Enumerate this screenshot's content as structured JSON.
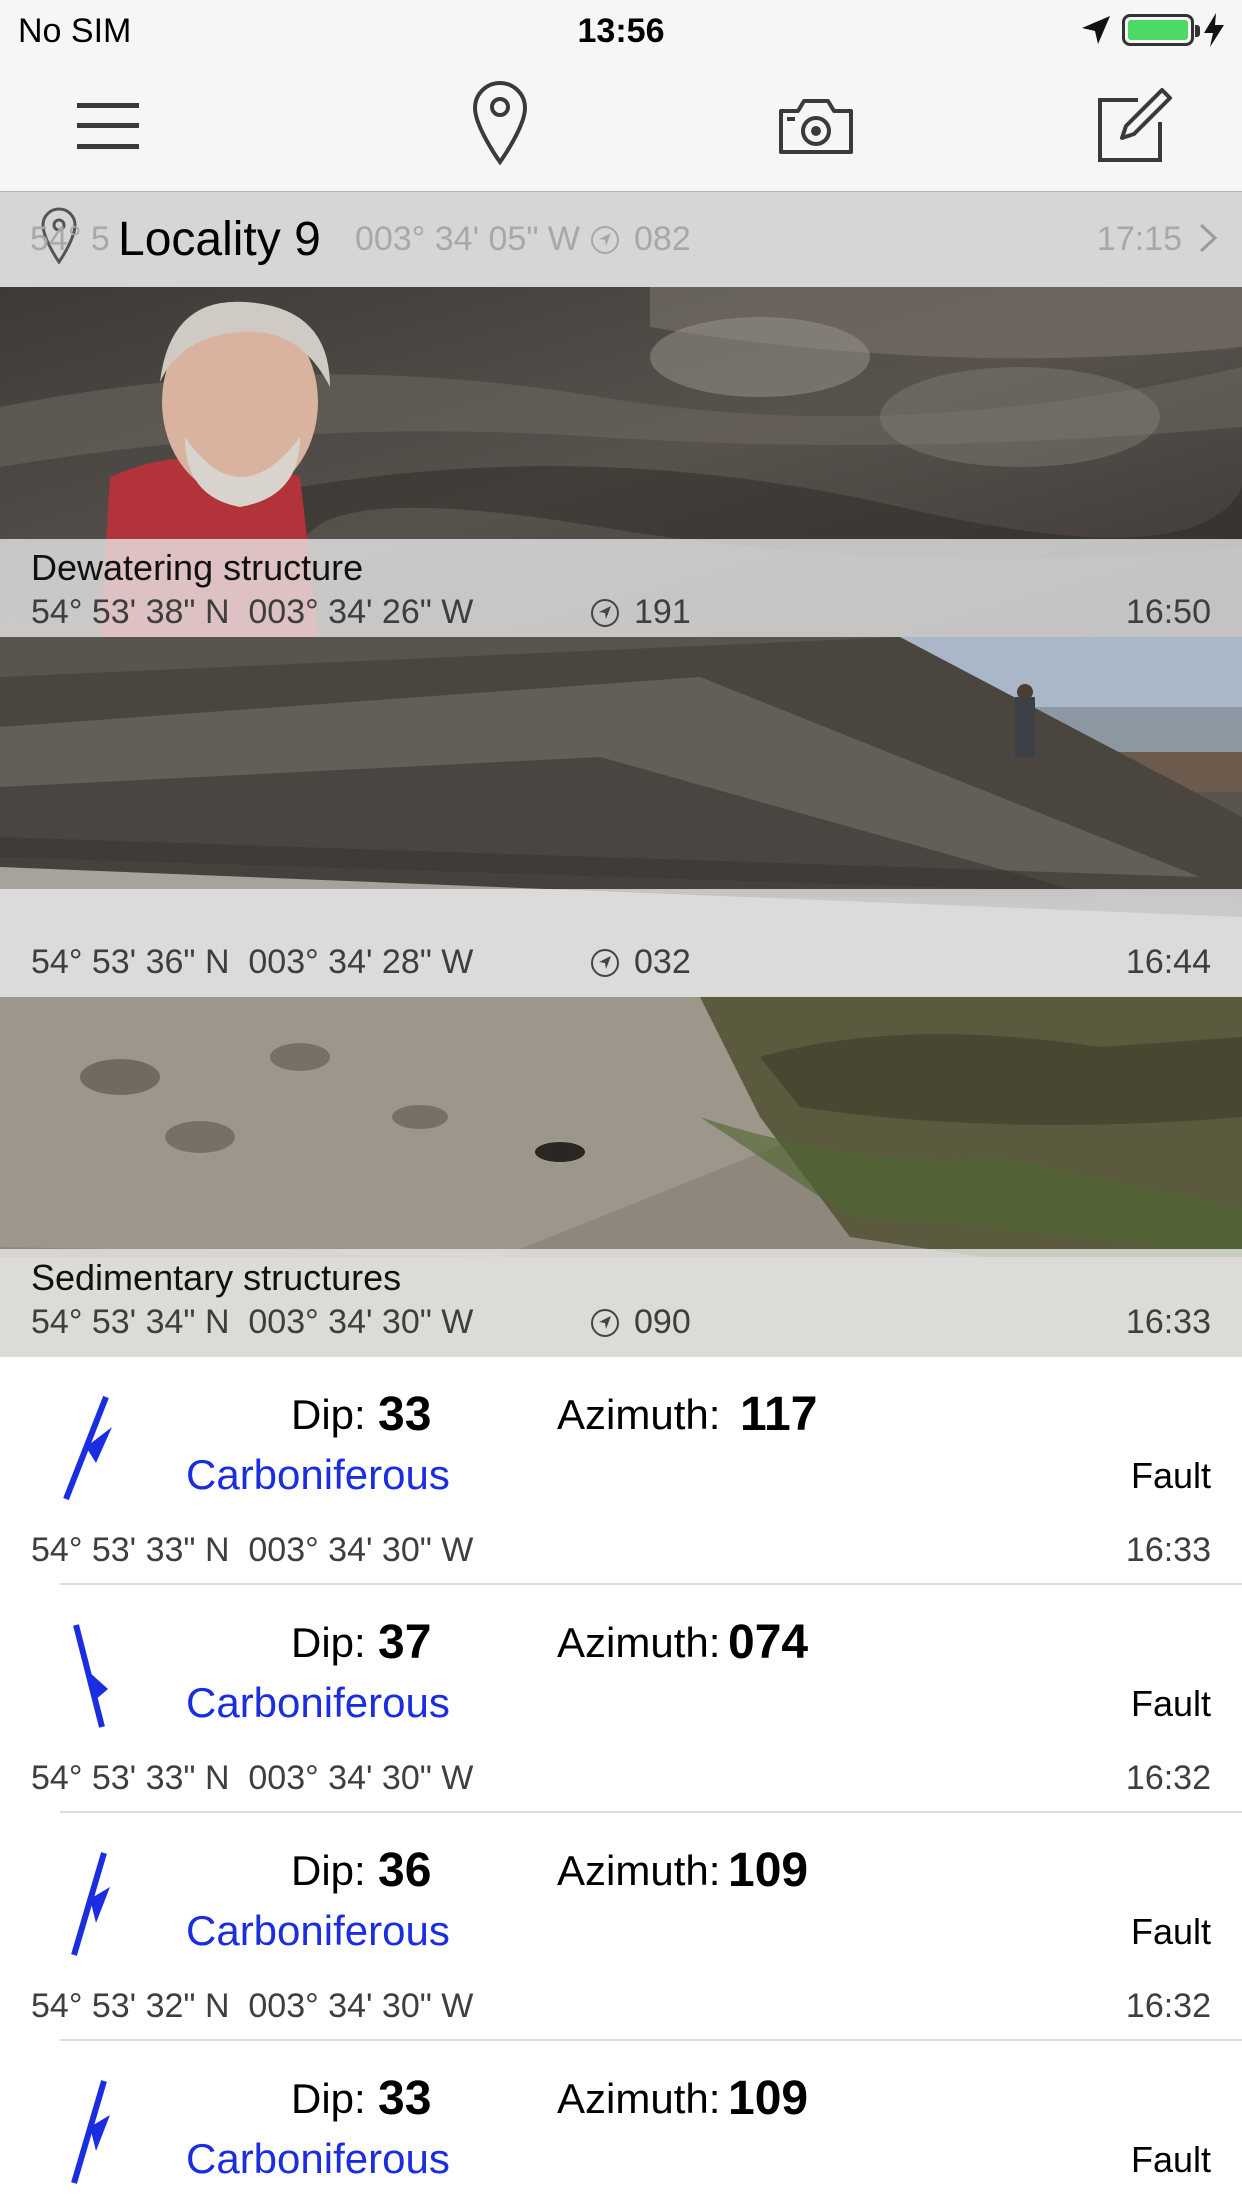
{
  "status": {
    "carrier": "No SIM",
    "time": "13:56"
  },
  "toolbar": {
    "icons": [
      "menu-icon",
      "location-pin-icon",
      "camera-icon",
      "compose-icon"
    ]
  },
  "locality": {
    "title": "Locality 9",
    "faded_lat": "54° 5",
    "faded_lon": "003° 34' 05\" W",
    "faded_bearing": "082",
    "faded_time": "17:15"
  },
  "photos": [
    {
      "title": "Dewatering structure",
      "coords": "54° 53' 38\" N  003° 34' 26\" W",
      "bearing": "191",
      "time": "16:50"
    },
    {
      "title": "",
      "coords": "54° 53' 36\" N  003° 34' 28\" W",
      "bearing": "032",
      "time": "16:44"
    },
    {
      "title": "Sedimentary structures",
      "coords": "54° 53' 34\" N  003° 34' 30\" W",
      "bearing": "090",
      "time": "16:33"
    }
  ],
  "measurements": [
    {
      "dip_label": "Dip:",
      "dip": "33",
      "az_label": "Azimuth:",
      "azimuth": "117",
      "period": "Carboniferous",
      "type": "Fault",
      "coords": "54° 53' 33\" N  003° 34' 30\" W",
      "time": "16:33"
    },
    {
      "dip_label": "Dip:",
      "dip": "37",
      "az_label": "Azimuth:",
      "azimuth": "074",
      "period": "Carboniferous",
      "type": "Fault",
      "coords": "54° 53' 33\" N  003° 34' 30\" W",
      "time": "16:32"
    },
    {
      "dip_label": "Dip:",
      "dip": "36",
      "az_label": "Azimuth:",
      "azimuth": "109",
      "period": "Carboniferous",
      "type": "Fault",
      "coords": "54° 53' 32\" N  003° 34' 30\" W",
      "time": "16:32"
    },
    {
      "dip_label": "Dip:",
      "dip": "33",
      "az_label": "Azimuth:",
      "azimuth": "109",
      "period": "Carboniferous",
      "type": "Fault",
      "coords": "",
      "time": ""
    }
  ],
  "colors": {
    "period_blue": "#1a2de0",
    "symbol_blue": "#1a2de0",
    "battery_green": "#4cd964"
  }
}
